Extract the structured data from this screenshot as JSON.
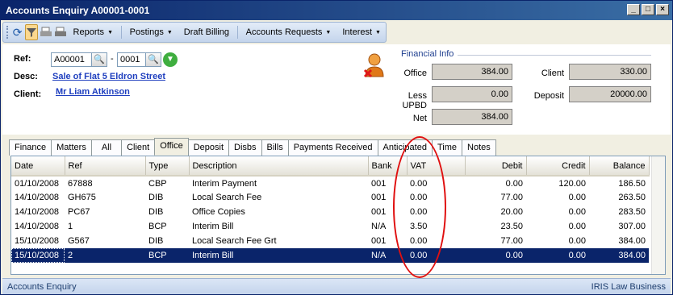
{
  "window": {
    "title": "Accounts Enquiry  A00001-0001"
  },
  "toolbar": {
    "menus": [
      "Reports",
      "Postings",
      "Draft Billing",
      "Accounts Requests",
      "Interest"
    ]
  },
  "header": {
    "ref_label": "Ref:",
    "ref_client": "A00001",
    "ref_sep": "-",
    "ref_matter": "0001",
    "desc_label": "Desc:",
    "desc_value": "Sale of Flat 5 Eldron Street",
    "client_label": "Client:",
    "client_value": "Mr Liam Atkinson"
  },
  "financial": {
    "title": "Financial Info",
    "office_label": "Office",
    "office_value": "384.00",
    "less_upbd_label": "Less UPBD",
    "less_upbd_value": "0.00",
    "net_label": "Net",
    "net_value": "384.00",
    "client_label": "Client",
    "client_value": "330.00",
    "deposit_label": "Deposit",
    "deposit_value": "20000.00"
  },
  "tabs": [
    "Finance",
    "Matters",
    "All",
    "Client",
    "Office",
    "Deposit",
    "Disbs",
    "Bills",
    "Payments Received",
    "Anticipated",
    "Time",
    "Notes"
  ],
  "active_tab": "Office",
  "grid": {
    "columns": [
      "Date",
      "Ref",
      "Type",
      "Description",
      "Bank",
      "VAT",
      "Debit",
      "Credit",
      "Balance"
    ],
    "rows": [
      [
        "01/10/2008",
        "67888",
        "CBP",
        "Interim Payment",
        "001",
        "0.00",
        "0.00",
        "120.00",
        "186.50"
      ],
      [
        "14/10/2008",
        "GH675",
        "DIB",
        "Local Search Fee",
        "001",
        "0.00",
        "77.00",
        "0.00",
        "263.50"
      ],
      [
        "14/10/2008",
        "PC67",
        "DIB",
        "Office Copies",
        "001",
        "0.00",
        "20.00",
        "0.00",
        "283.50"
      ],
      [
        "14/10/2008",
        "1",
        "BCP",
        "Interim Bill",
        "N/A",
        "3.50",
        "23.50",
        "0.00",
        "307.00"
      ],
      [
        "15/10/2008",
        "G567",
        "DIB",
        "Local Search Fee Grt",
        "001",
        "0.00",
        "77.00",
        "0.00",
        "384.00"
      ],
      [
        "15/10/2008",
        "2",
        "BCP",
        "Interim Bill",
        "N/A",
        "0.00",
        "0.00",
        "0.00",
        "384.00"
      ]
    ],
    "selected_row": 5
  },
  "status": {
    "left": "Accounts Enquiry",
    "right": "IRIS Law Business"
  },
  "colors": {
    "title_bar": "#0a246a",
    "selection": "#0a246a",
    "annotation": "#e01010",
    "link": "#1f3fbf"
  }
}
